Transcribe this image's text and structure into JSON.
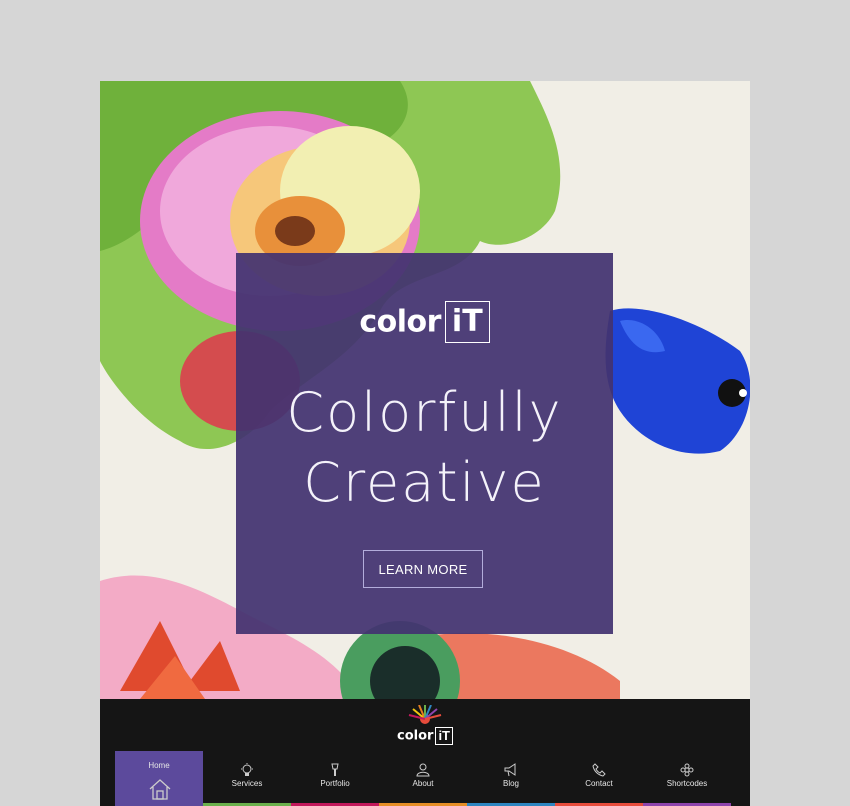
{
  "hero": {
    "logo_word": "color",
    "logo_box": "iT",
    "headline_line1": "Colorfully",
    "headline_line2": "Creative",
    "cta_label": "LEARN MORE"
  },
  "nav": {
    "logo_word": "color",
    "logo_box": "iT",
    "items": [
      {
        "label": "Home",
        "icon": "home-icon",
        "color": "#5c4a9c"
      },
      {
        "label": "Services",
        "icon": "lightbulb-icon",
        "color": "#6ab04c"
      },
      {
        "label": "Portfolio",
        "icon": "brush-icon",
        "color": "#c2185b"
      },
      {
        "label": "About",
        "icon": "person-icon",
        "color": "#e58e26"
      },
      {
        "label": "Blog",
        "icon": "megaphone-icon",
        "color": "#2e86c1"
      },
      {
        "label": "Contact",
        "icon": "phone-icon",
        "color": "#e74c3c"
      },
      {
        "label": "Shortcodes",
        "icon": "flower-icon",
        "color": "#8e44ad"
      }
    ]
  },
  "colors": {
    "overlay": "#433370",
    "navbar": "#151515",
    "active_tab": "#5c4a9c"
  }
}
